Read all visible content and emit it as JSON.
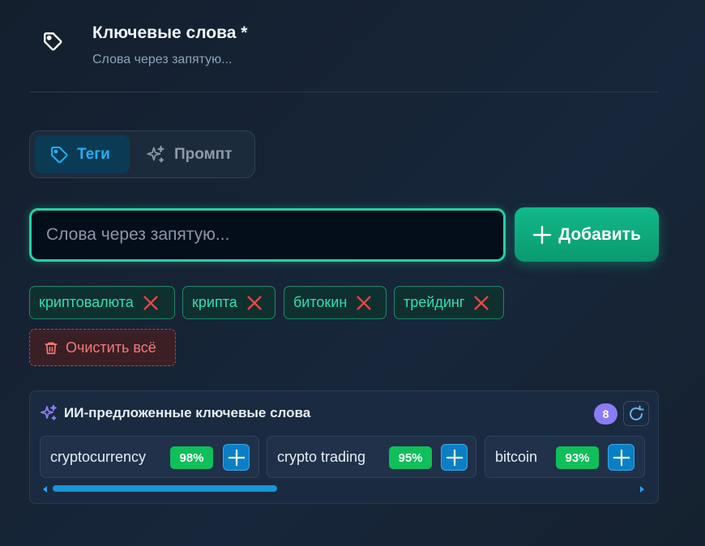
{
  "header": {
    "title": "Ключевые слова *",
    "subtitle": "Слова через запятую..."
  },
  "mode": {
    "tabs": [
      {
        "label": "Теги",
        "icon": "tag-icon",
        "active": true
      },
      {
        "label": "Промпт",
        "icon": "sparkles-icon",
        "active": false
      }
    ]
  },
  "input": {
    "placeholder": "Слова через запятую...",
    "value": ""
  },
  "add_button": {
    "label": "Добавить",
    "icon": "plus-icon"
  },
  "tags": [
    {
      "label": "криптовалюта"
    },
    {
      "label": "крипта"
    },
    {
      "label": "битокин"
    },
    {
      "label": "трейдинг"
    }
  ],
  "clear_button": {
    "label": "Очистить всё",
    "icon": "trash-icon"
  },
  "suggestions": {
    "title": "ИИ-предложенные ключевые слова",
    "count": "8",
    "items": [
      {
        "word": "cryptocurrency",
        "score": "98%"
      },
      {
        "word": "crypto trading",
        "score": "95%"
      },
      {
        "word": "bitcoin",
        "score": "93%"
      }
    ],
    "scroll_progress": 0.38
  },
  "colors": {
    "accent_teal": "#22d3a4",
    "accent_blue": "#22b0f0",
    "add_green": "#10b981",
    "danger": "#f47a7a",
    "badge_purple": "#8b7cf6",
    "score_green": "#0fbf5a"
  }
}
